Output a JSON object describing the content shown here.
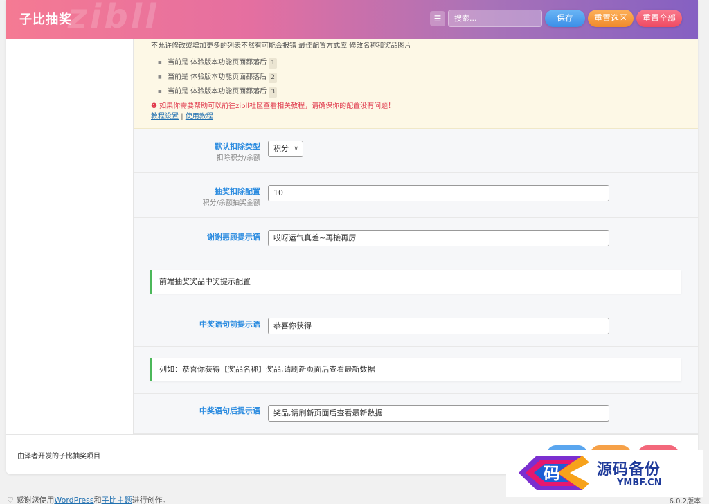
{
  "header": {
    "title": "子比抽奖",
    "watermark": "zibll",
    "search_placeholder": "搜索...",
    "save_label": "保存",
    "reset_section_label": "重置选区",
    "reset_all_label": "重置全部"
  },
  "notice": {
    "top_line": "不允许修改或增加更多的列表不然有可能会报错 最佳配置方式应 修改名称和奖品图片",
    "items": [
      {
        "text": "当前是 体验版本功能页面都落后",
        "num": "1"
      },
      {
        "text": "当前是 体验版本功能页面都落后",
        "num": "2"
      },
      {
        "text": "当前是 体验版本功能页面都落后",
        "num": "3"
      }
    ],
    "warning": "❶ 如果你需要帮助可以前往zibll社区查看相关教程，请确保你的配置没有问题！",
    "link1": "教程设置",
    "separator": "|",
    "link2": "使用教程"
  },
  "fields": {
    "deduct_type": {
      "label": "默认扣除类型",
      "sub": "扣除积分/余额",
      "value": "积分"
    },
    "deduct_config": {
      "label": "抽奖扣除配置",
      "sub": "积分/余额抽奖金额",
      "value": "10"
    },
    "thanks_prompt": {
      "label": "谢谢惠顾提示语",
      "value": "哎呀运气真差~再接再厉"
    },
    "prize_prefix": {
      "label": "中奖语句前提示语",
      "value": "恭喜你获得"
    },
    "prize_suffix": {
      "label": "中奖语句后提示语",
      "value": "奖品,请刷新页面后查看最新数据"
    }
  },
  "subheads": {
    "prize_config": "前端抽奖奖品中奖提示配置",
    "example": "列如：恭喜你获得【奖品名称】奖品,请刷新页面后查看最新数据"
  },
  "footer": {
    "credit": "由泽者开发的子比抽奖项目"
  },
  "wp": {
    "thanks_prefix": "感谢您使用",
    "wordpress": "WordPress",
    "and": "和",
    "theme": "子比主题",
    "thanks_suffix": "进行创作。",
    "version": "6.0.2版本"
  },
  "logo": {
    "glyph": "码",
    "brand": "源码备份",
    "domain": "YMBF.CN"
  },
  "colors": {
    "accent": "#2e8de0",
    "header_start": "#f57a93",
    "header_end": "#8560c2",
    "notice_bg": "#fdf8e6",
    "success_bar": "#4cb85a",
    "warning": "#e0394c"
  }
}
